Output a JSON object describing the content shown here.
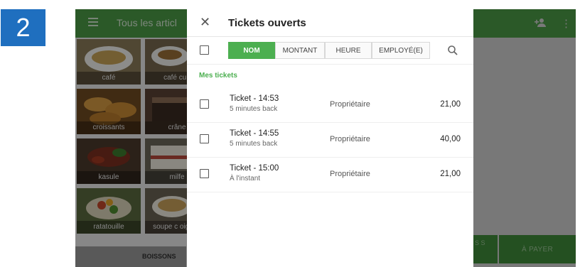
{
  "step_number": "2",
  "app": {
    "title": "Tous les articl",
    "menu_icon": "menu-icon",
    "add_user_icon": "add-user-icon",
    "more_icon": "more-vert-icon",
    "brand_color": "#4b9a46"
  },
  "items": [
    {
      "label": "café"
    },
    {
      "label": "café cub"
    },
    {
      "label": "croissants"
    },
    {
      "label": "crâne"
    },
    {
      "label": "kasule"
    },
    {
      "label": "milfe"
    },
    {
      "label": "ratatouille"
    },
    {
      "label": "soupe c oignon"
    }
  ],
  "bottom_tab": {
    "label": "BOISSONS"
  },
  "side_button": {
    "label": "S S"
  },
  "pay_button": {
    "label": "À PAYER"
  },
  "dialog": {
    "title": "Tickets ouverts",
    "close_icon": "close-icon",
    "sort_tabs": [
      {
        "label": "NOM",
        "active": true
      },
      {
        "label": "MONTANT",
        "active": false
      },
      {
        "label": "HEURE",
        "active": false
      },
      {
        "label": "EMPLOYÉ(E)",
        "active": false
      }
    ],
    "search_icon": "search-icon",
    "section_label": "Mes tickets",
    "accent_color": "#4caf50",
    "tickets": [
      {
        "name": "Ticket - 14:53",
        "time": "5 minutes back",
        "owner": "Propriétaire",
        "amount": "21,00"
      },
      {
        "name": "Ticket - 14:55",
        "time": "5 minutes back",
        "owner": "Propriétaire",
        "amount": "40,00"
      },
      {
        "name": "Ticket - 15:00",
        "time": "À l'instant",
        "owner": "Propriétaire",
        "amount": "21,00"
      }
    ]
  }
}
